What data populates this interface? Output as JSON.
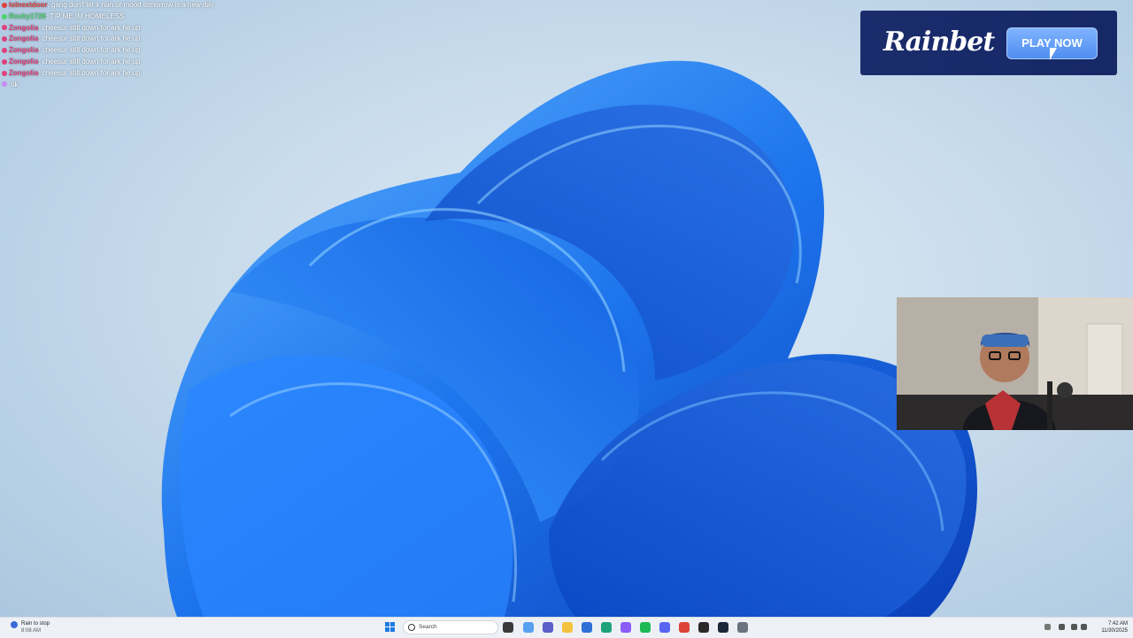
{
  "chat": [
    {
      "user": "lolnextdoor",
      "text": "gang don't let ir ruin ur mood tomorrow is a new day",
      "color": "#e04040"
    },
    {
      "user": "Rocky1726",
      "text": "TIP ME IM HOMELESS",
      "color": "#49d36b"
    },
    {
      "user": "Zongolia",
      "text": "cheesur still down for ark he up",
      "color": "#e0407a"
    },
    {
      "user": "Zongolia",
      "text": "cheesur still down for ark he up",
      "color": "#e0407a"
    },
    {
      "user": "Zongolia",
      "text": "cheesur still down for ark he up",
      "color": "#e0407a"
    },
    {
      "user": "Zongolia",
      "text": "cheesur still down for ark he up",
      "color": "#e0407a"
    },
    {
      "user": "Zongolia",
      "text": "cheesur still down for ark he up",
      "color": "#e0407a"
    },
    {
      "user": "",
      "text": "ok",
      "color": "#c78cf0"
    }
  ],
  "ad": {
    "brand": "Rainbet",
    "cta": "PLAY NOW"
  },
  "taskbar": {
    "weather_label": "Rain to stop",
    "weather_sub": "8:08 AM",
    "search_placeholder": "Search",
    "time": "7:42 AM",
    "date": "11/30/2025"
  },
  "colors": {
    "accent": "#1e7ae0",
    "ad_bg": "#1a2c6b",
    "cta": "#5a96f2"
  }
}
